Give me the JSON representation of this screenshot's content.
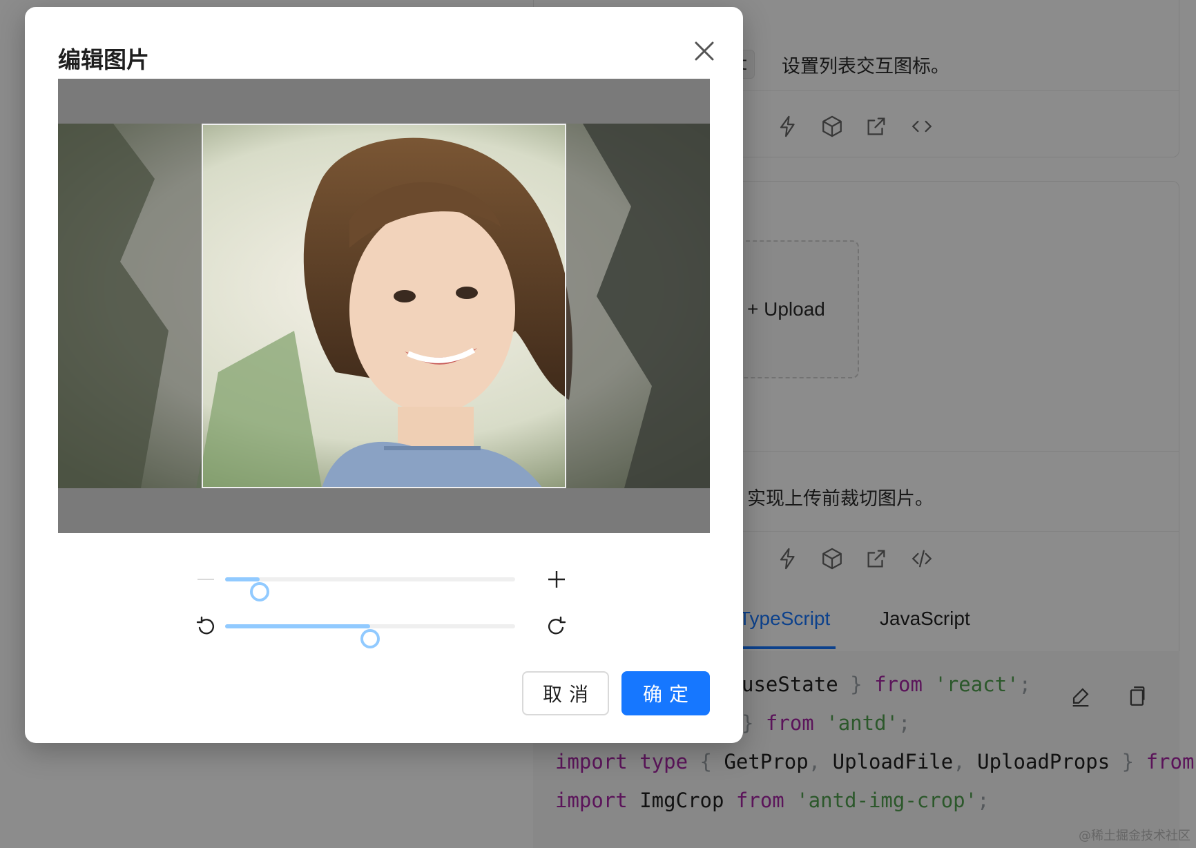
{
  "background": {
    "demo1": {
      "code_chip": "st",
      "description": "设置列表交互图标。",
      "actions": [
        "lightning-icon",
        "codesandbox-icon",
        "external-link-icon",
        "code-icon"
      ]
    },
    "demo2": {
      "upload_label": "+ Upload",
      "description": "实现上传前裁切图片。",
      "actions": [
        "lightning-icon",
        "codesandbox-icon",
        "external-link-icon",
        "code-slash-icon"
      ],
      "tabs": [
        {
          "label": "TypeScript",
          "active": true
        },
        {
          "label": "JavaScript",
          "active": false
        }
      ],
      "code": {
        "line1": {
          "text": "useState",
          "close": " } ",
          "from": "from",
          "str": "'react'",
          "end": ";"
        },
        "line2": {
          "close": "} ",
          "from": "from",
          "str": "'antd'",
          "end": ";"
        },
        "line3": {
          "import": "import",
          "type": " type",
          "open": " { ",
          "a": "GetProp",
          "c1": ", ",
          "b": "UploadFile",
          "c2": ", ",
          "c": "UploadProps",
          "close": " } ",
          "from": "from"
        },
        "line4": {
          "import": "import",
          "name": " ImgCrop ",
          "from": "from",
          "str": " 'antd-img-crop'",
          "end": ";"
        }
      }
    },
    "watermark": "@稀土掘金技术社区"
  },
  "modal": {
    "title": "编辑图片",
    "zoom": {
      "value": 0.12
    },
    "rotate": {
      "value": 0.5
    },
    "cancel_label": "取消",
    "ok_label": "确定"
  },
  "colors": {
    "primary": "#1677ff",
    "slider": "#91caff",
    "mask": "rgba(0,0,0,0.45)"
  }
}
